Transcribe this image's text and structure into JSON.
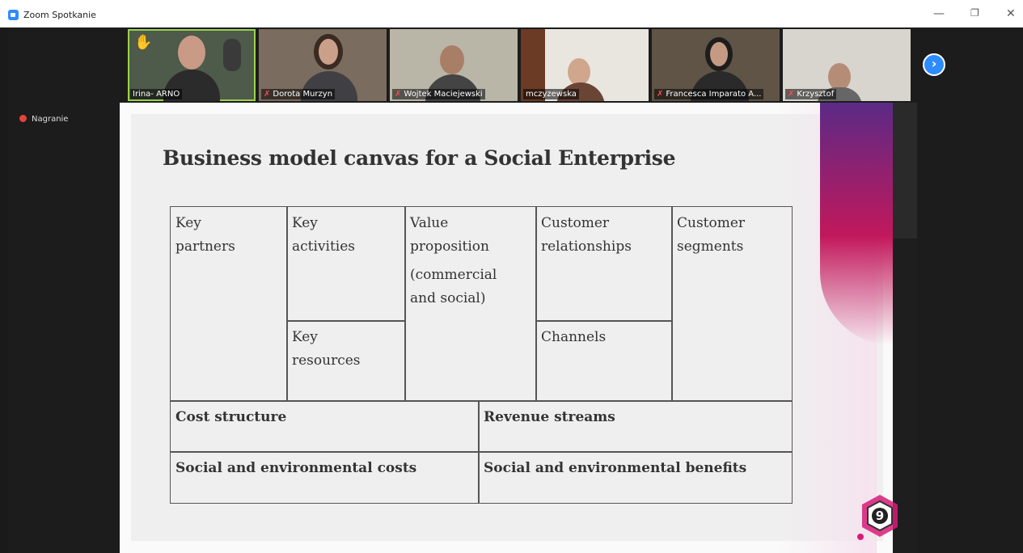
{
  "window": {
    "title": "Zoom Spotkanie"
  },
  "participants": [
    {
      "name": "Irina- ARNO",
      "hand": true
    },
    {
      "name": "Dorota Murzyn"
    },
    {
      "name": "Wojtek Maciejewski"
    },
    {
      "name": "mczyzewska"
    },
    {
      "name": "Francesca Imparato A..."
    },
    {
      "name": "Krzysztof"
    }
  ],
  "recording": {
    "label": "Nagranie"
  },
  "slide": {
    "title": "Business model canvas for a Social Enterprise",
    "cells": {
      "key_partners": [
        "Key",
        "partners"
      ],
      "key_activities": [
        "Key",
        "activities"
      ],
      "key_resources": [
        "Key",
        "resources"
      ],
      "value_proposition": [
        "Value",
        "proposition"
      ],
      "value_proposition_sub": [
        "(commercial",
        "and social)"
      ],
      "customer_relationships": [
        "Customer",
        "relationships"
      ],
      "channels": "Channels",
      "customer_segments": [
        "Customer",
        "segments"
      ],
      "cost_structure": "Cost structure",
      "revenue_streams": "Revenue streams",
      "social_costs": "Social and environmental costs",
      "social_benefits": "Social and environmental benefits"
    },
    "logo_number": "9"
  },
  "colors": {
    "accent": "#2d8cff",
    "active_speaker": "#9bd24a",
    "muted_mic": "#ff4a4a",
    "record": "#e0453a"
  }
}
